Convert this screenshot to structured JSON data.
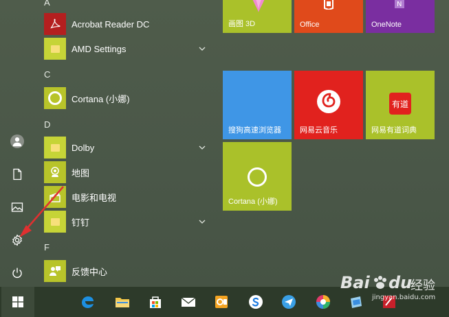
{
  "letters": [
    "A",
    "C",
    "D",
    "F"
  ],
  "apps": [
    {
      "name": "Acrobat Reader DC"
    },
    {
      "name": "AMD Settings"
    },
    {
      "name": "Cortana (小娜)"
    },
    {
      "name": "Dolby"
    },
    {
      "name": "地图"
    },
    {
      "name": "电影和电视"
    },
    {
      "name": "钉钉"
    },
    {
      "name": "反馈中心"
    }
  ],
  "tiles": [
    {
      "label": "画图 3D"
    },
    {
      "label": "Office"
    },
    {
      "label": "OneNote"
    },
    {
      "label": "搜狗高速浏览器"
    },
    {
      "label": "网易云音乐"
    },
    {
      "label": "网易有道词典"
    },
    {
      "label": "Cortana (小娜)"
    }
  ],
  "tile_icon_text": {
    "youdao": "有道"
  },
  "watermark": {
    "brand": "Bai",
    "brand2": "du",
    "suffix": "经验",
    "url": "jingyan.baidu.com"
  },
  "colors": {
    "accent_green": "#b8c42a",
    "office_orange": "#e04a1b",
    "onenote_purple": "#7a2ea0",
    "annotation_arrow": "#e03030"
  }
}
